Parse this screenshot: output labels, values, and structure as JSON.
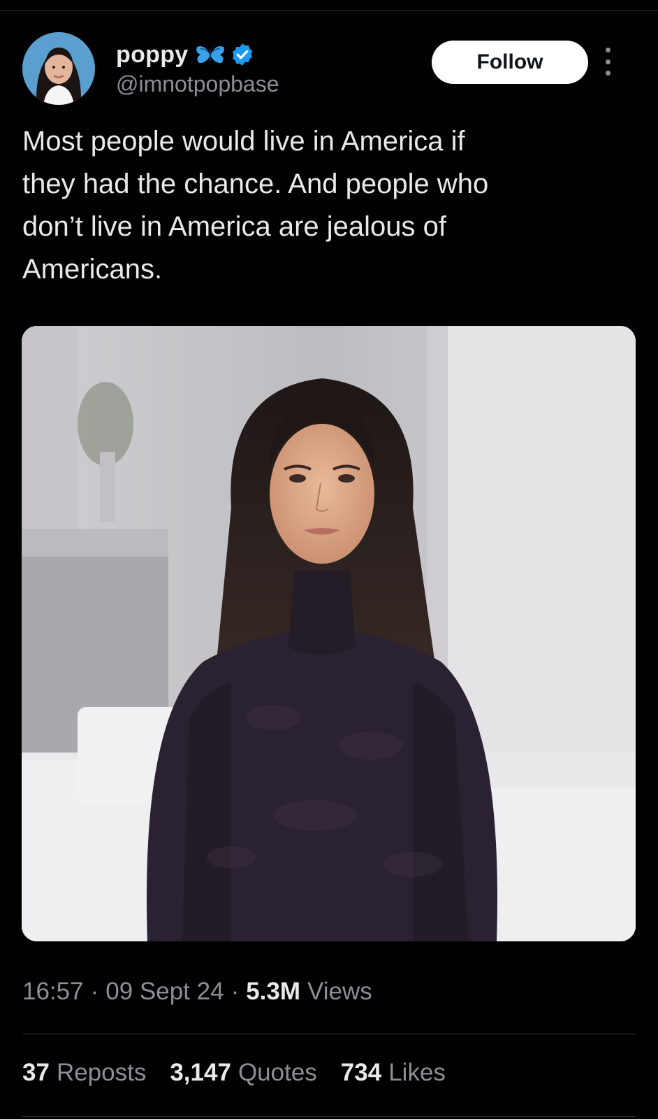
{
  "author": {
    "display_name": "poppy",
    "handle": "@imnotpopbase",
    "verified_icon": "verified-badge-icon",
    "emoji_icon": "butterfly-icon",
    "accent_color": "#1d9bf0"
  },
  "header": {
    "follow_label": "Follow",
    "more_icon": "more-vertical-icon"
  },
  "tweet": {
    "text": "Most people would live in America if\nthey had the chance. And people who\ndon’t live in America are jealous of\nAmericans."
  },
  "meta": {
    "time": "16:57",
    "separator": "·",
    "date": "09 Sept 24",
    "views_count": "5.3M",
    "views_label": "Views"
  },
  "stats": {
    "reposts_count": "37",
    "reposts_label": "Reposts",
    "quotes_count": "3,147",
    "quotes_label": "Quotes",
    "likes_count": "734",
    "likes_label": "Likes"
  }
}
